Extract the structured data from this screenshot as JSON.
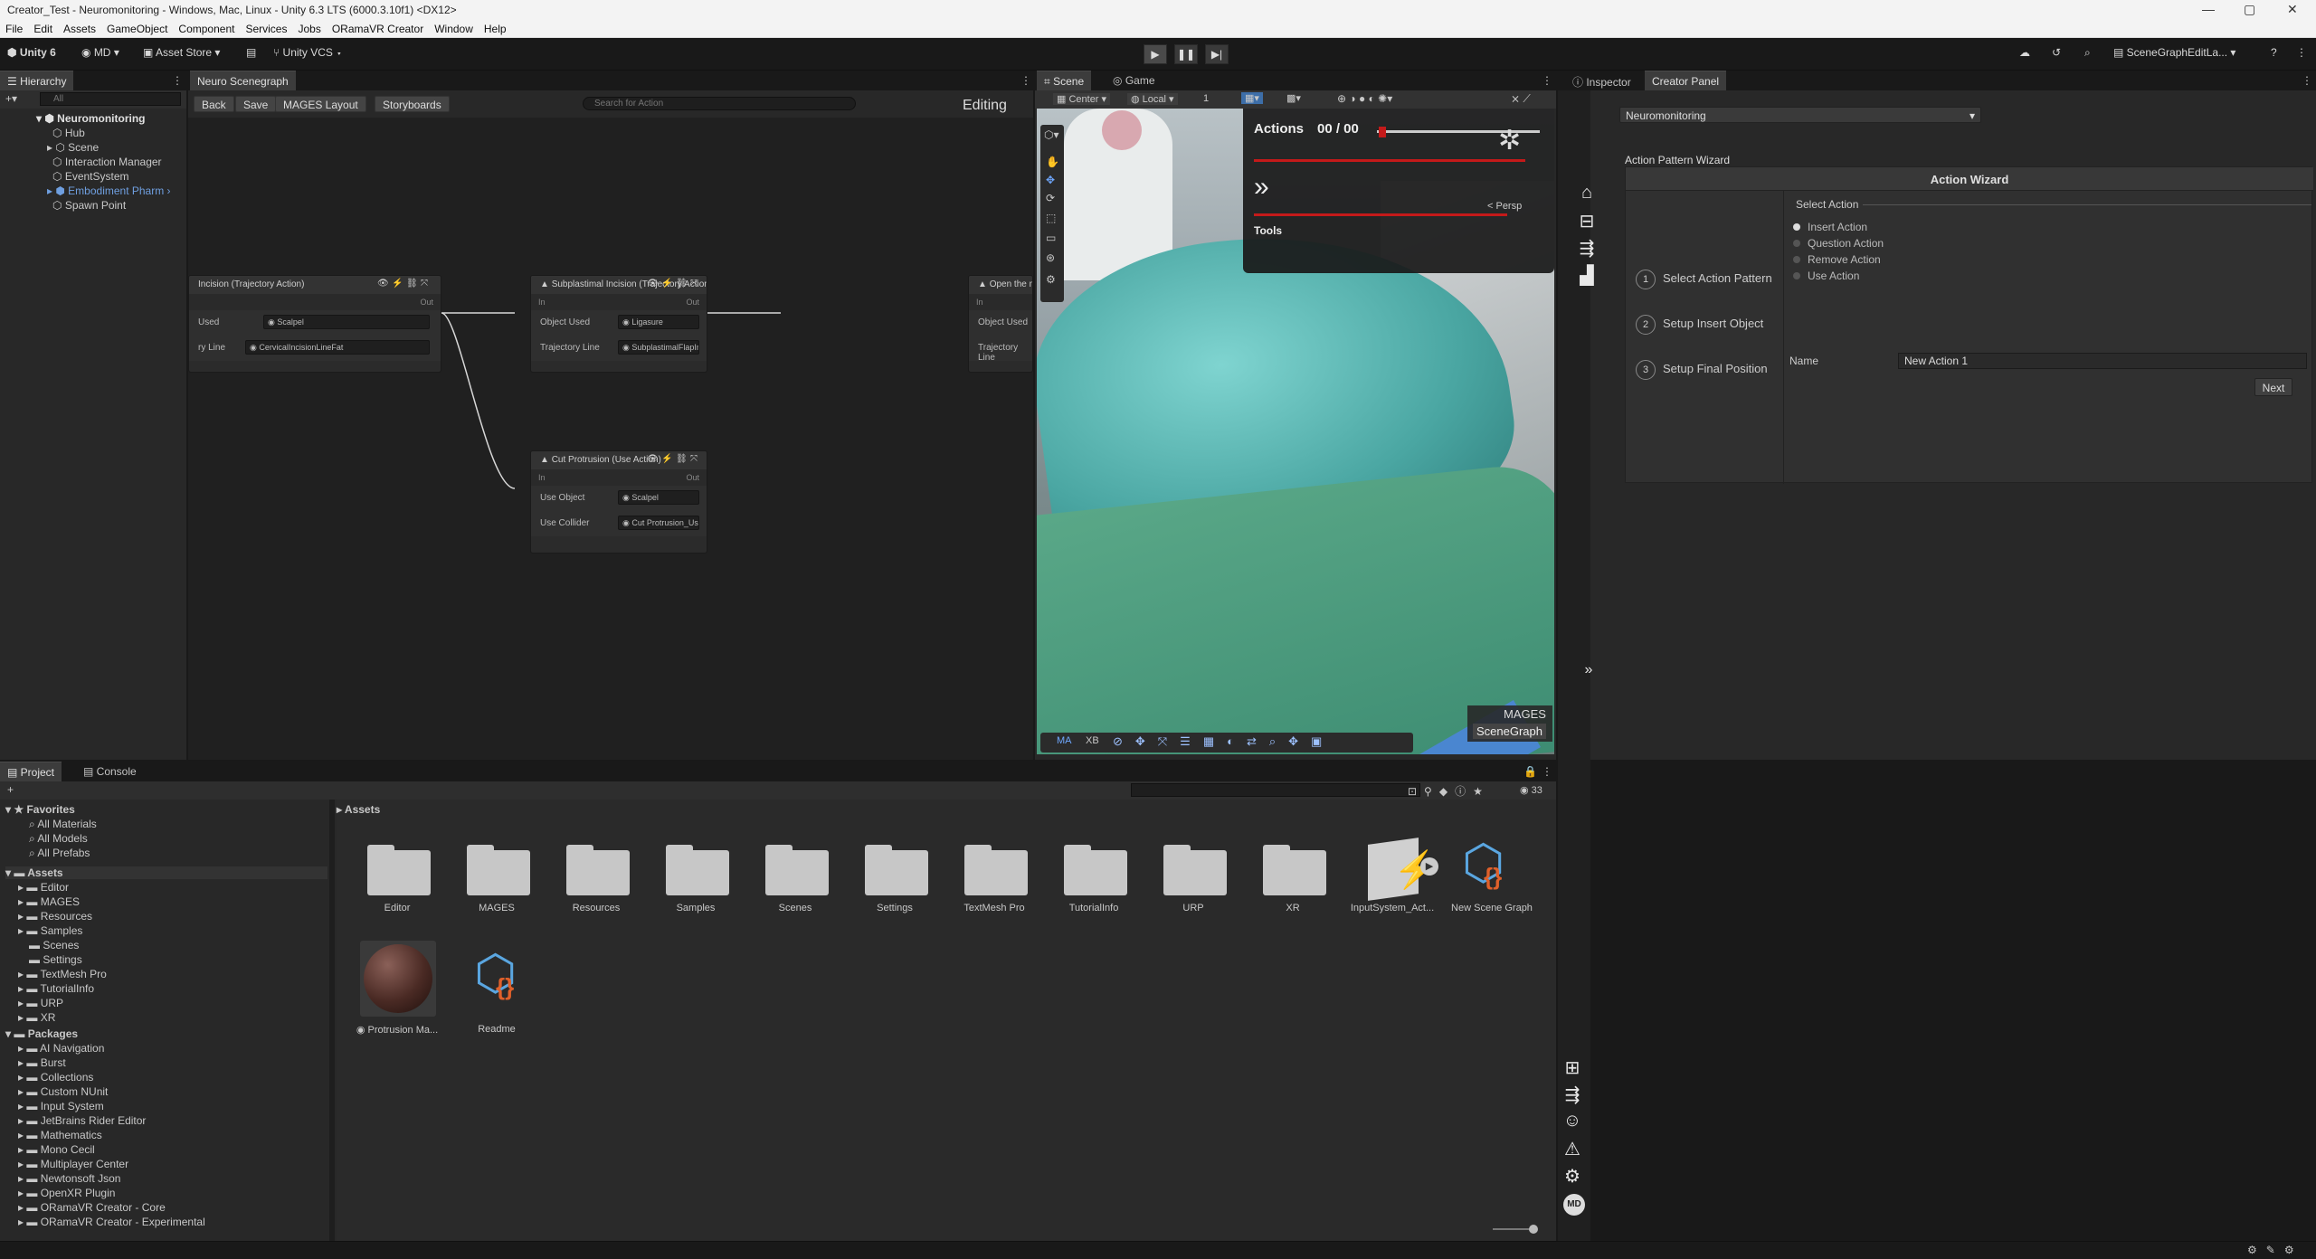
{
  "window": {
    "title": "Creator_Test - Neuromonitoring - Windows, Mac, Linux - Unity 6.3 LTS (6000.3.10f1) <DX12>",
    "minimize": "—",
    "maximize": "▢",
    "close": "✕"
  },
  "menu": [
    "File",
    "Edit",
    "Assets",
    "GameObject",
    "Component",
    "Services",
    "Jobs",
    "ORamaVR Creator",
    "Window",
    "Help"
  ],
  "toolbar": {
    "unity": "Unity 6",
    "account": "MD",
    "asset_store": "Asset Store",
    "vcs": "Unity VCS",
    "layout": "SceneGraphEditLa..."
  },
  "hierarchy": {
    "tab": "Hierarchy",
    "search_placeholder": "All",
    "root": "Neuromonitoring",
    "items": [
      "Hub",
      "Scene",
      "Interaction Manager",
      "EventSystem",
      "Embodiment Pharm",
      "Spawn Point"
    ]
  },
  "scenegraph": {
    "tab": "Neuro Scenegraph",
    "back": "Back",
    "save": "Save",
    "layout": "MAGES Layout",
    "storyboards": "Storyboards",
    "search_placeholder": "Search for Action",
    "mode": "Editing",
    "nodes": [
      {
        "title": "Incision (Trajectory Action)",
        "in": "",
        "out": "Out",
        "rows": [
          {
            "label": "Used",
            "value": "Scalpel"
          },
          {
            "label": "ry Line",
            "value": "CervicalIncisionLineFat"
          }
        ]
      },
      {
        "title": "Subplastimal Incision (Trajectory Action)",
        "in": "In",
        "out": "Out",
        "rows": [
          {
            "label": "Object Used",
            "value": "Ligasure"
          },
          {
            "label": "Trajectory Line",
            "value": "SubplastimalFlapIncision"
          }
        ]
      },
      {
        "title": "Open the m",
        "in": "In",
        "out": "",
        "rows": [
          {
            "label": "Object Used",
            "value": ""
          },
          {
            "label": "Trajectory Line",
            "value": ""
          }
        ]
      },
      {
        "title": "Cut Protrusion (Use Action)",
        "in": "In",
        "out": "Out",
        "rows": [
          {
            "label": "Use Object",
            "value": "Scalpel"
          },
          {
            "label": "Use Collider",
            "value": "Cut Protrusion_UseTarget"
          }
        ]
      }
    ]
  },
  "scene": {
    "tab_scene": "Scene",
    "tab_game": "Game",
    "pivot": "Center",
    "space": "Local",
    "grid": "1",
    "persp": "< Persp",
    "hud_actions": "Actions",
    "hud_count": "00 / 00",
    "hud_tools": "Tools",
    "overlay_brand": "MAGES",
    "overlay_btn": "SceneGraph",
    "bottom_tools": [
      "MA",
      "XB"
    ]
  },
  "inspector": {
    "tab_inspector": "Inspector",
    "tab_creator": "Creator Panel",
    "dropdown": "Neuromonitoring",
    "wizard_label": "Action Pattern Wizard",
    "wizard_title": "Action Wizard",
    "steps": [
      {
        "num": "1",
        "label": "Select Action Pattern"
      },
      {
        "num": "2",
        "label": "Setup Insert Object"
      },
      {
        "num": "3",
        "label": "Setup Final Position"
      }
    ],
    "select_action": "Select Action",
    "options": [
      "Insert Action",
      "Question Action",
      "Remove Action",
      "Use Action"
    ],
    "selected": 0,
    "name_label": "Name",
    "name_value": "New Action 1",
    "next": "Next"
  },
  "project": {
    "tab_project": "Project",
    "tab_console": "Console",
    "favorites": "Favorites",
    "fav_items": [
      "All Materials",
      "All Models",
      "All Prefabs"
    ],
    "assets": "Assets",
    "asset_folders": [
      "Editor",
      "MAGES",
      "Resources",
      "Samples",
      "Scenes",
      "Settings",
      "TextMesh Pro",
      "TutorialInfo",
      "URP",
      "XR"
    ],
    "packages": "Packages",
    "package_items": [
      "AI Navigation",
      "Burst",
      "Collections",
      "Custom NUnit",
      "Input System",
      "JetBrains Rider Editor",
      "Mathematics",
      "Mono Cecil",
      "Multiplayer Center",
      "Newtonsoft Json",
      "OpenXR Plugin",
      "ORamaVR Creator - Core",
      "ORamaVR Creator - Experimental"
    ],
    "breadcrumb": "Assets",
    "count": "33",
    "grid": [
      "Editor",
      "MAGES",
      "Resources",
      "Samples",
      "Scenes",
      "Settings",
      "TextMesh Pro",
      "TutorialInfo",
      "URP",
      "XR",
      "InputSystem_Act...",
      "New Scene Graph",
      "Protrusion Ma...",
      "Readme"
    ]
  },
  "colors": {
    "accent": "#3d6ea8",
    "node_link": "#d8d8d8",
    "red": "#c41a1a"
  }
}
